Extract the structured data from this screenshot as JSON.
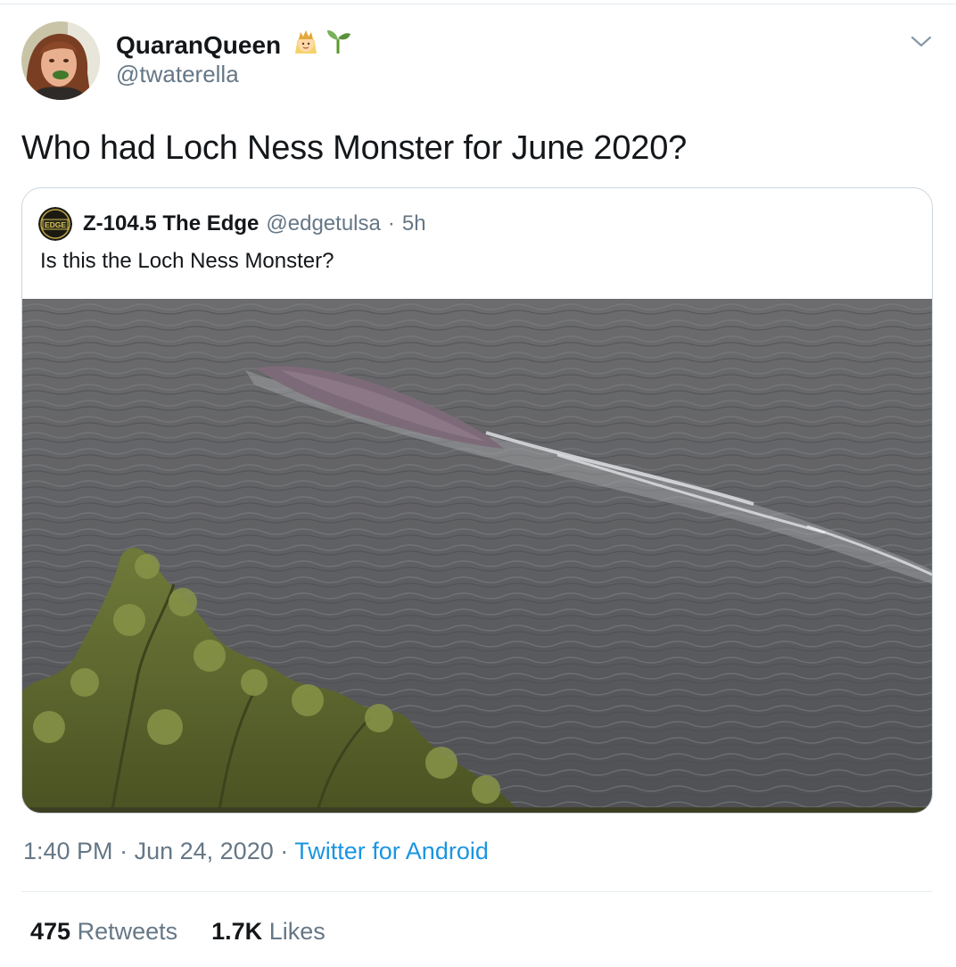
{
  "author": {
    "name": "QuaranQueen",
    "emojis": [
      "princess-emoji",
      "seedling-emoji"
    ],
    "handle": "@twaterella"
  },
  "tweet": {
    "text": "Who had Loch Ness Monster for June 2020?"
  },
  "quoted": {
    "name": "Z-104.5 The Edge",
    "handle": "@edgetulsa",
    "separator": "·",
    "time": "5h",
    "text": "Is this the Loch Ness Monster?",
    "avatar_text": "EDGE",
    "media_icon": "loch-ness-photo"
  },
  "meta": {
    "time": "1:40 PM",
    "sep1": "·",
    "date": "Jun 24, 2020",
    "sep2": "·",
    "source": "Twitter for Android"
  },
  "stats": {
    "retweets_count": "475",
    "retweets_label": "Retweets",
    "likes_count": "1.7K",
    "likes_label": "Likes"
  },
  "colors": {
    "link": "#1b95e0",
    "secondary_text": "#657786",
    "border": "#ccd6dd"
  }
}
